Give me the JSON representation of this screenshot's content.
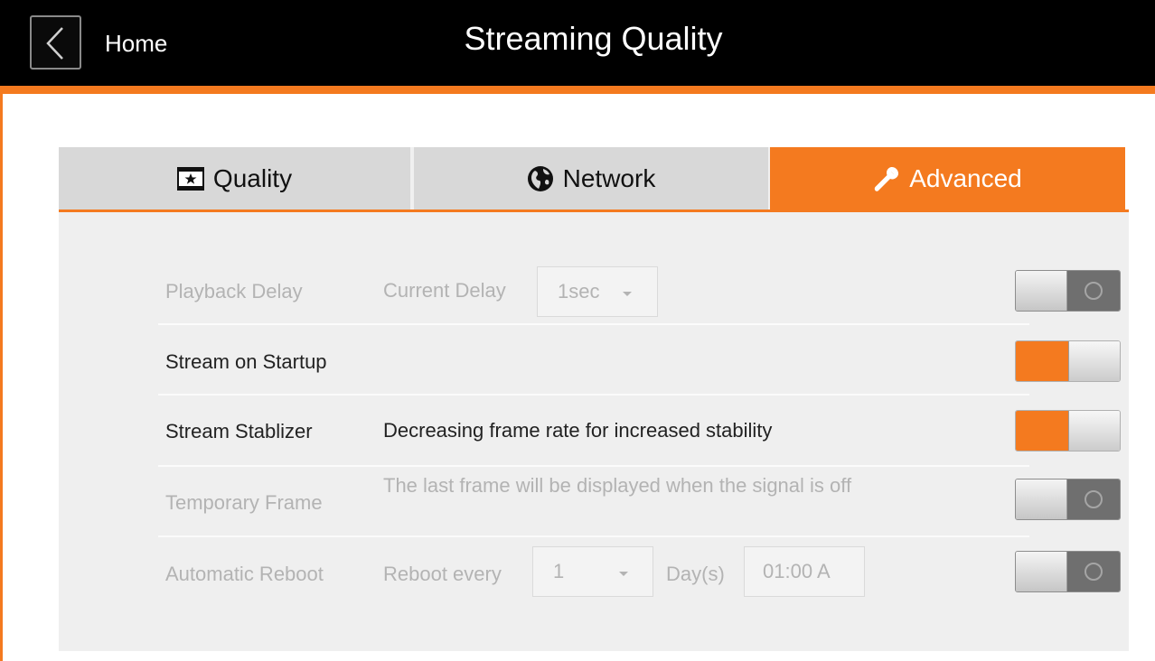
{
  "header": {
    "back_label": "Home",
    "title": "Streaming Quality"
  },
  "tabs": [
    {
      "label": "Quality",
      "icon": "film-star-icon",
      "active": false
    },
    {
      "label": "Network",
      "icon": "globe-icon",
      "active": false
    },
    {
      "label": "Advanced",
      "icon": "wrench-icon",
      "active": true
    }
  ],
  "settings": {
    "playback_delay": {
      "label": "Playback Delay",
      "sub_label": "Current Delay",
      "selected": "1sec",
      "enabled": false
    },
    "stream_on_startup": {
      "label": "Stream on Startup",
      "enabled": true
    },
    "stream_stabilizer": {
      "label": "Stream Stablizer",
      "description": "Decreasing frame rate for increased stability",
      "enabled": true
    },
    "temporary_frame": {
      "label": "Temporary Frame",
      "description": "The last frame will be displayed when the signal is off",
      "enabled": false
    },
    "automatic_reboot": {
      "label": "Automatic Reboot",
      "sub_label": "Reboot every",
      "interval": "1",
      "unit": "Day(s)",
      "time": "01:00 A",
      "enabled": false
    }
  },
  "colors": {
    "accent": "#f47a1f",
    "header_bg": "#000000",
    "panel_bg": "#efefef",
    "disabled_text": "#b3b3b3"
  }
}
